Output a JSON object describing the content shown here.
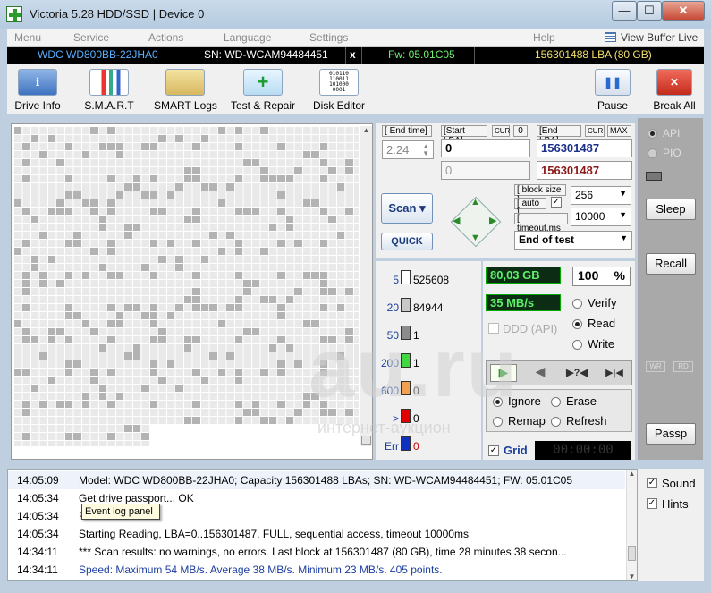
{
  "window": {
    "title": "Victoria 5.28 HDD/SSD | Device 0",
    "min": "—",
    "max": "☐",
    "close": "✕"
  },
  "menu": [
    "Menu",
    "Service",
    "Actions",
    "Language",
    "Settings",
    "Help"
  ],
  "view_buffer": "View Buffer Live",
  "info": {
    "model": "WDC WD800BB-22JHA0",
    "serial": "SN: WD-WCAM94484451",
    "close_x": "x",
    "firmware": "Fw: 05.01C05",
    "capacity": "156301488 LBA (80 GB)"
  },
  "toolbar": [
    "Drive Info",
    "S.M.A.R.T",
    "SMART Logs",
    "Test & Repair",
    "Disk Editor",
    "Pause",
    "Break All"
  ],
  "scan": {
    "end_time_label": "End time",
    "end_time": "2:24",
    "start_lba_label": "Start LBA",
    "cur": "CUR",
    "zero": "0",
    "start_lba": "0",
    "start_lba2": "0",
    "end_lba_label": "End LBA",
    "max": "MAX",
    "end_lba": "156301487",
    "end_lba2": "156301487",
    "block_size_label": "block size",
    "auto_label": "auto",
    "timeout_label": "timeout,ms",
    "block_size": "256",
    "timeout": "10000",
    "scan_button": "Scan",
    "quick_button": "QUICK",
    "end_action": "End of test"
  },
  "stats": [
    {
      "label": "5",
      "count": "525608",
      "color": "#ffffff",
      "label_color": "#1a3f9a"
    },
    {
      "label": "20",
      "count": "84944",
      "color": "#c8c8c8",
      "label_color": "#1a3f9a"
    },
    {
      "label": "50",
      "count": "1",
      "color": "#8c8c8c",
      "label_color": "#1a3f9a"
    },
    {
      "label": "200",
      "count": "1",
      "color": "#3fd93f",
      "label_color": "#1a3f9a"
    },
    {
      "label": "600",
      "count": "0",
      "color": "#f2a050",
      "label_color": "#1a3f9a"
    },
    {
      "label": ">",
      "count": "0",
      "color": "#e00000",
      "label_color": "#1a3f9a"
    },
    {
      "label": "Err",
      "count": "0",
      "color": "#1030c0",
      "label_color": "#1a3f9a"
    }
  ],
  "progress": {
    "processed": "80,03 GB",
    "percent": "100",
    "percent_sign": "%",
    "speed": "35 MB/s",
    "ddd": "DDD (API)"
  },
  "mode": {
    "verify": "Verify",
    "read": "Read",
    "write": "Write"
  },
  "repair": {
    "ignore": "Ignore",
    "erase": "Erase",
    "remap": "Remap",
    "refresh": "Refresh"
  },
  "grid_label": "Grid",
  "timer": "00:00:00",
  "side": {
    "api": "API",
    "pio": "PIO",
    "sleep": "Sleep",
    "recall": "Recall",
    "wr": "WR",
    "rd": "RD",
    "passp": "Passp"
  },
  "log": [
    {
      "time": "14:05:09",
      "msg": "Model: WDC WD800BB-22JHA0; Capacity 156301488 LBAs; SN: WD-WCAM94484451; FW: 05.01C05",
      "color": "#000"
    },
    {
      "time": "14:05:34",
      "msg": "Get drive passport... OK",
      "color": "#000"
    },
    {
      "time": "14:05:34",
      "msg": "R... OK",
      "color": "#000"
    },
    {
      "time": "14:05:34",
      "msg": "Starting Reading, LBA=0..156301487, FULL, sequential access, timeout 10000ms",
      "color": "#000"
    },
    {
      "time": "14:34:11",
      "msg": "*** Scan results: no warnings, no errors. Last block at 156301487 (80 GB), time 28 minutes 38 secon...",
      "color": "#000"
    },
    {
      "time": "14:34:11",
      "msg": "Speed: Maximum 54 MB/s. Average 38 MB/s. Minimum 23 MB/s. 405 points.",
      "color": "#1c3ea0"
    }
  ],
  "tooltip": "Event log panel",
  "checks": {
    "sound": "Sound",
    "hints": "Hints"
  },
  "watermark": {
    "big": "au.ru",
    "small": "интернет-аукцион"
  },
  "colors": {
    "accent": "#1a3f9a",
    "lcd_bg": "#0c2d14",
    "lcd_fg": "#5ff06a"
  }
}
